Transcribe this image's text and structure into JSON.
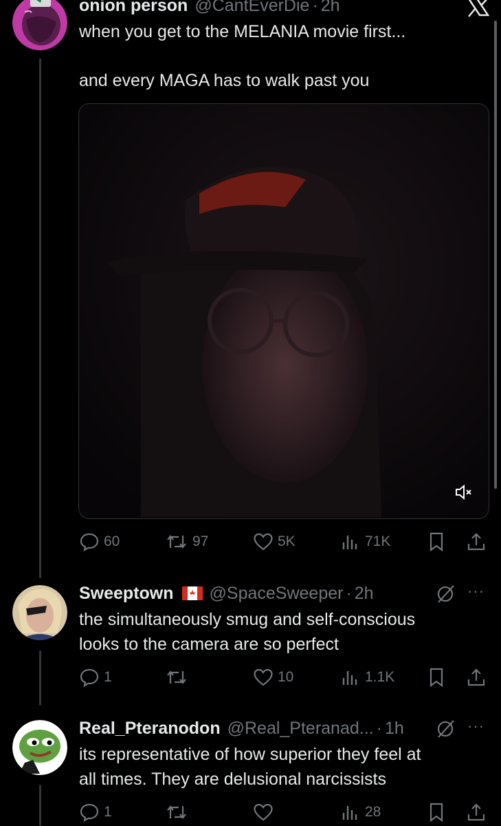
{
  "tweet": {
    "name": "onion person",
    "handle": "@CantEverDie",
    "time": "2h",
    "line1": "when you get to the MELANIA movie first...",
    "line2": "and every MAGA has to walk past you",
    "media_icon": "mute-icon",
    "actions": {
      "replies": "60",
      "reposts": "97",
      "likes": "5K",
      "views": "71K"
    }
  },
  "replies": [
    {
      "name": "Sweeptown",
      "flag": "🇨🇦",
      "handle": "@SpaceSweeper",
      "time": "2h",
      "line1": "the simultaneously smug and self-conscious",
      "line2": "looks to the camera are so perfect",
      "actions": {
        "replies": "1",
        "reposts": "",
        "likes": "10",
        "views": "1.1K"
      }
    },
    {
      "name": "Real_Pteranodon",
      "handle": "@Real_Pteranad...",
      "time": "1h",
      "line1": "its representative of how superior they feel at",
      "line2": "all times. They are delusional narcissists",
      "actions": {
        "replies": "1",
        "reposts": "",
        "likes": "",
        "views": "28"
      }
    }
  ],
  "header": {
    "close_icon": "x-close-icon"
  },
  "colors": {
    "background": "#000000",
    "text": "#e7e9ea",
    "secondary": "#71767b",
    "hat_red": "#8a1f16"
  }
}
